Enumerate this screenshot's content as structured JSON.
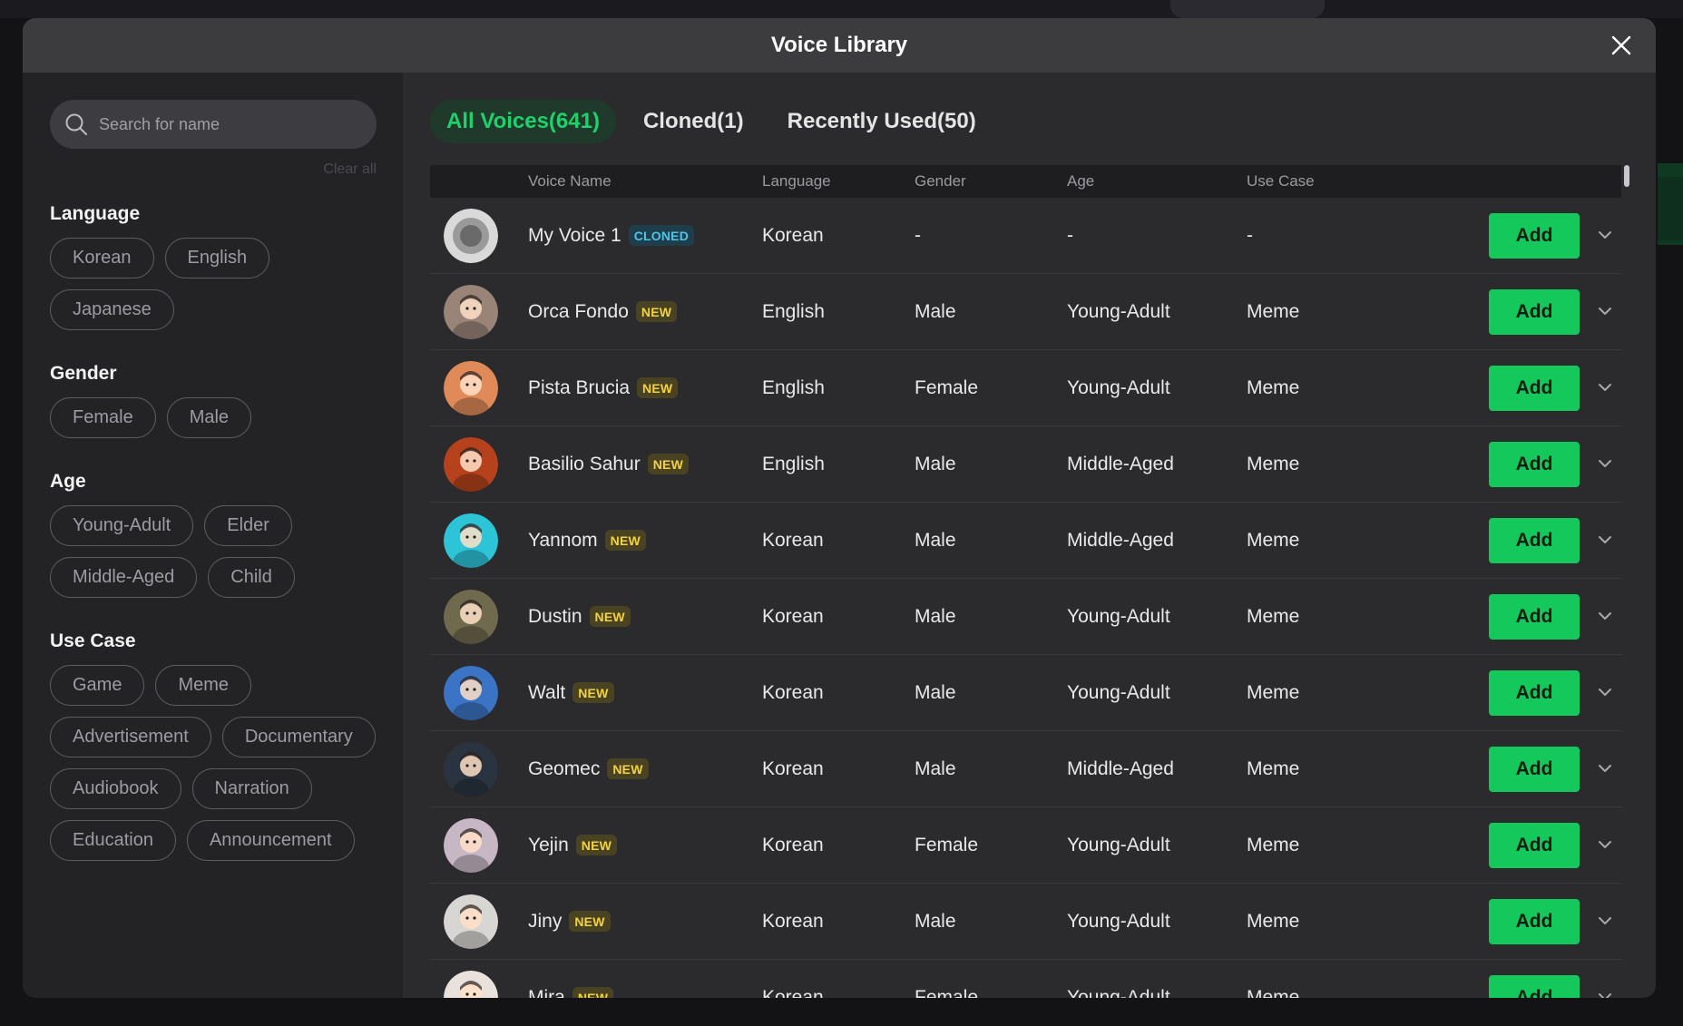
{
  "modal": {
    "title": "Voice Library"
  },
  "search": {
    "placeholder": "Search for name",
    "clear_all": "Clear all"
  },
  "filters": [
    {
      "title": "Language",
      "options": [
        "Korean",
        "English",
        "Japanese"
      ]
    },
    {
      "title": "Gender",
      "options": [
        "Female",
        "Male"
      ]
    },
    {
      "title": "Age",
      "options": [
        "Young-Adult",
        "Elder",
        "Middle-Aged",
        "Child"
      ]
    },
    {
      "title": "Use Case",
      "options": [
        "Game",
        "Meme",
        "Advertisement",
        "Documentary",
        "Audiobook",
        "Narration",
        "Education",
        "Announcement"
      ]
    }
  ],
  "tabs": [
    {
      "label": "All Voices(641)",
      "active": true
    },
    {
      "label": "Cloned(1)",
      "active": false
    },
    {
      "label": "Recently Used(50)",
      "active": false
    }
  ],
  "table": {
    "headers": {
      "name": "Voice Name",
      "language": "Language",
      "gender": "Gender",
      "age": "Age",
      "use_case": "Use Case"
    },
    "add_label": "Add",
    "rows": [
      {
        "name": "My Voice 1",
        "badge": "CLONED",
        "badge_type": "cloned",
        "language": "Korean",
        "gender": "-",
        "age": "-",
        "use_case": "-",
        "avatar": "placeholder",
        "avatar_color": "#8a8a8a"
      },
      {
        "name": "Orca Fondo",
        "badge": "NEW",
        "badge_type": "new",
        "language": "English",
        "gender": "Male",
        "age": "Young-Adult",
        "use_case": "Meme",
        "avatar": "shark",
        "avatar_color": "#9a8478"
      },
      {
        "name": "Pista Brucia",
        "badge": "NEW",
        "badge_type": "new",
        "language": "English",
        "gender": "Female",
        "age": "Young-Adult",
        "use_case": "Meme",
        "avatar": "icecream",
        "avatar_color": "#e08a5a"
      },
      {
        "name": "Basilio Sahur",
        "badge": "NEW",
        "badge_type": "new",
        "language": "English",
        "gender": "Male",
        "age": "Middle-Aged",
        "use_case": "Meme",
        "avatar": "creature",
        "avatar_color": "#b5421c"
      },
      {
        "name": "Yannom",
        "badge": "NEW",
        "badge_type": "new",
        "language": "Korean",
        "gender": "Male",
        "age": "Middle-Aged",
        "use_case": "Meme",
        "avatar": "cartoon-man",
        "avatar_color": "#2ec4d8"
      },
      {
        "name": "Dustin",
        "badge": "NEW",
        "badge_type": "new",
        "language": "Korean",
        "gender": "Male",
        "age": "Young-Adult",
        "use_case": "Meme",
        "avatar": "reader",
        "avatar_color": "#6f6a4e"
      },
      {
        "name": "Walt",
        "badge": "NEW",
        "badge_type": "new",
        "language": "Korean",
        "gender": "Male",
        "age": "Young-Adult",
        "use_case": "Meme",
        "avatar": "painter",
        "avatar_color": "#3b74c4"
      },
      {
        "name": "Geomec",
        "badge": "NEW",
        "badge_type": "new",
        "language": "Korean",
        "gender": "Male",
        "age": "Middle-Aged",
        "use_case": "Meme",
        "avatar": "suit-man",
        "avatar_color": "#2a3440"
      },
      {
        "name": "Yejin",
        "badge": "NEW",
        "badge_type": "new",
        "language": "Korean",
        "gender": "Female",
        "age": "Young-Adult",
        "use_case": "Meme",
        "avatar": "girl",
        "avatar_color": "#c7b7c4"
      },
      {
        "name": "Jiny",
        "badge": "NEW",
        "badge_type": "new",
        "language": "Korean",
        "gender": "Male",
        "age": "Young-Adult",
        "use_case": "Meme",
        "avatar": "boy",
        "avatar_color": "#d8d6d2"
      },
      {
        "name": "Mira",
        "badge": "NEW",
        "badge_type": "new",
        "language": "Korean",
        "gender": "Female",
        "age": "Young-Adult",
        "use_case": "Meme",
        "avatar": "woman",
        "avatar_color": "#e9e2dc"
      }
    ]
  },
  "colors": {
    "accent": "#14c85c",
    "modal_bg": "#2b2b2e",
    "sidebar_bg": "#232326",
    "header_bg": "#3c3c3f"
  }
}
